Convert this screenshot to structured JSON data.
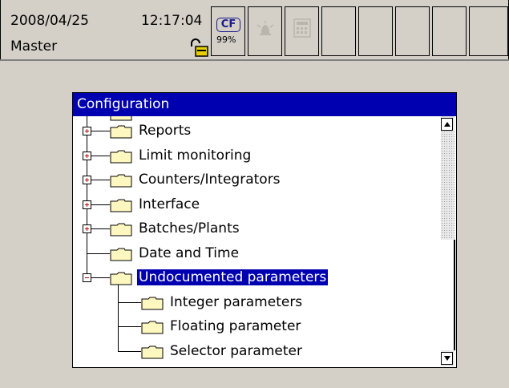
{
  "status_bar": {
    "date": "2008/04/25",
    "time": "12:17:04",
    "device": "Master",
    "cf_label": "CF",
    "cf_percent": "99%"
  },
  "dialog": {
    "title": "Configuration",
    "tree": [
      {
        "label": "Reports",
        "level": 0,
        "expander": "plus"
      },
      {
        "label": "Limit monitoring",
        "level": 0,
        "expander": "plus"
      },
      {
        "label": "Counters/Integrators",
        "level": 0,
        "expander": "plus"
      },
      {
        "label": "Interface",
        "level": 0,
        "expander": "plus"
      },
      {
        "label": "Batches/Plants",
        "level": 0,
        "expander": "plus"
      },
      {
        "label": "Date and Time",
        "level": 0,
        "expander": "none"
      },
      {
        "label": "Undocumented parameters",
        "level": 0,
        "expander": "minus",
        "selected": true
      },
      {
        "label": "Integer parameters",
        "level": 1,
        "expander": "none"
      },
      {
        "label": "Floating parameter",
        "level": 1,
        "expander": "none"
      },
      {
        "label": "Selector parameter",
        "level": 1,
        "expander": "none"
      }
    ]
  },
  "colors": {
    "title_bar": "#0000b0",
    "selection": "#0000b0",
    "folder": "#fff7c0",
    "expander_sign": "#c00000",
    "background": "#d4d0c8"
  }
}
